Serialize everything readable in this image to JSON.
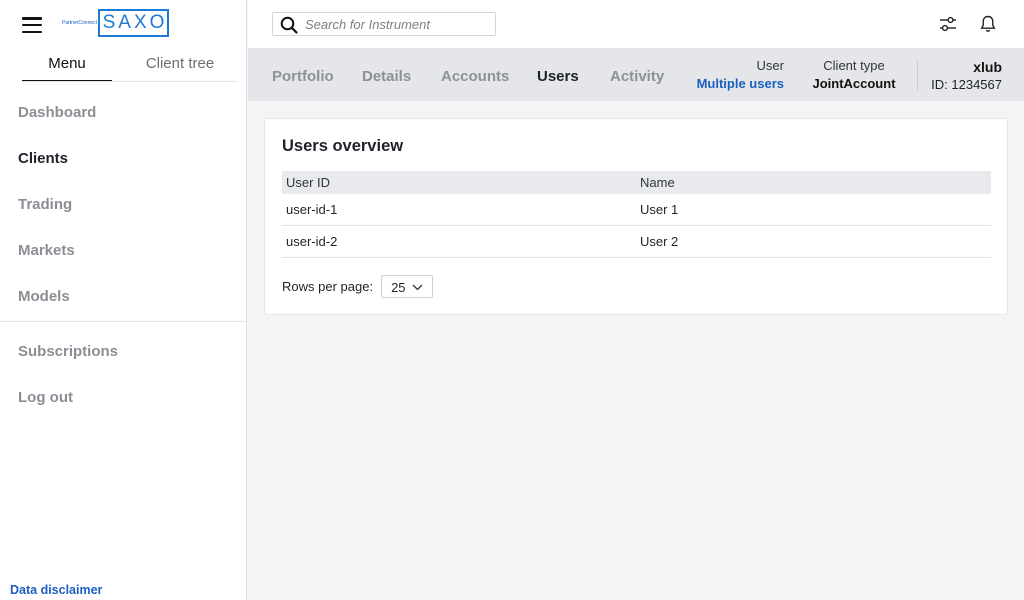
{
  "brand": {
    "partner_text": "PartnerConnect",
    "logo_text": "SAXO",
    "color": "#1b7bd6"
  },
  "sidebar": {
    "tabs": [
      {
        "label": "Menu",
        "active": true
      },
      {
        "label": "Client tree",
        "active": false
      }
    ],
    "items": [
      {
        "label": "Dashboard",
        "active": false
      },
      {
        "label": "Clients",
        "active": true
      },
      {
        "label": "Trading",
        "active": false
      },
      {
        "label": "Markets",
        "active": false
      },
      {
        "label": "Models",
        "active": false
      }
    ],
    "items2": [
      {
        "label": "Subscriptions"
      },
      {
        "label": "Log out"
      }
    ],
    "disclaimer": "Data disclaimer"
  },
  "topbar": {
    "search_placeholder": "Search for Instrument",
    "icons": [
      "search-icon",
      "filter-settings-icon",
      "bell-icon"
    ]
  },
  "client_nav": {
    "tabs": [
      {
        "label": "Portfolio",
        "active": false
      },
      {
        "label": "Details",
        "active": false
      },
      {
        "label": "Accounts",
        "active": false
      },
      {
        "label": "Users",
        "active": true
      },
      {
        "label": "Activity",
        "active": false
      }
    ],
    "user_label": "User",
    "user_value": "Multiple users",
    "user_value_color": "#1b5fbf",
    "client_type_label": "Client type",
    "client_type_value": "JointAccount",
    "client_name": "xlub",
    "client_id": "ID: 1234567"
  },
  "users_overview": {
    "title": "Users overview",
    "columns": [
      "User ID",
      "Name"
    ],
    "rows": [
      {
        "user_id": "user-id-1",
        "name": "User 1"
      },
      {
        "user_id": "user-id-2",
        "name": "User 2"
      }
    ],
    "rows_per_page_label": "Rows per page:",
    "rows_per_page_value": "25"
  }
}
